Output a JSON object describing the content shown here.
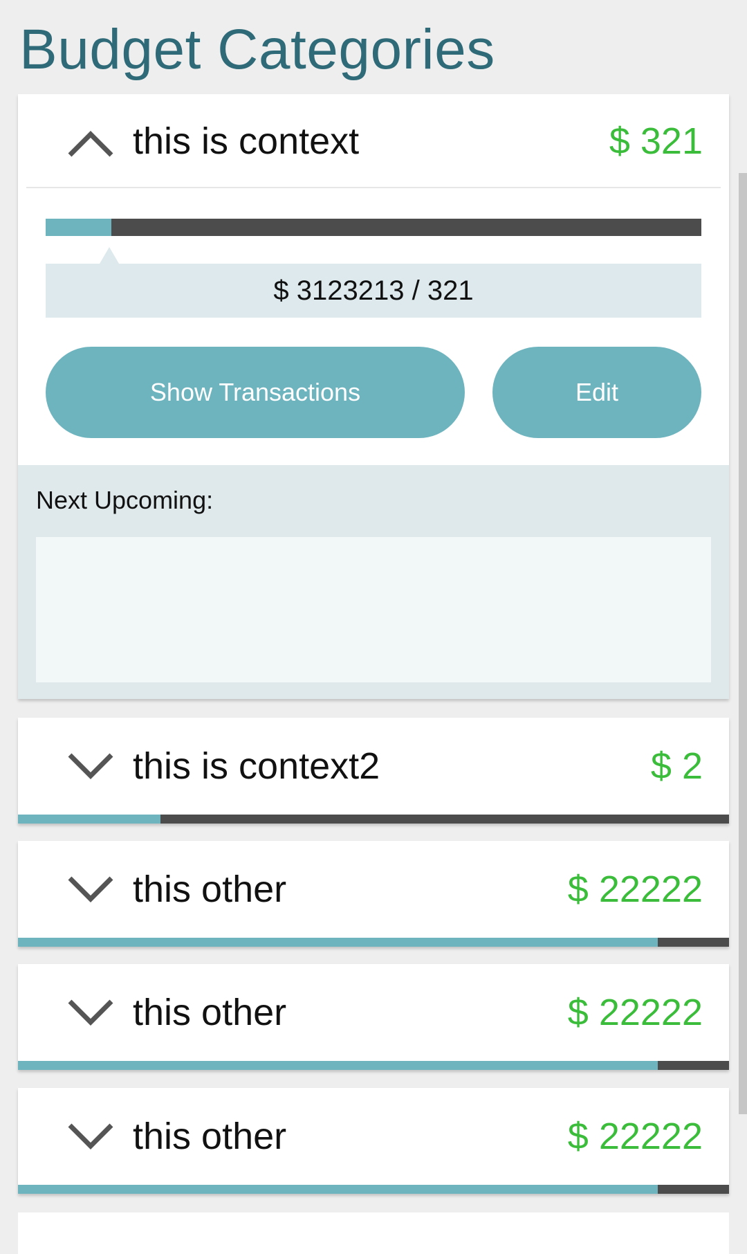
{
  "page": {
    "title": "Budget Categories"
  },
  "colors": {
    "title": "#2f6a78",
    "amount": "#3bbd3b",
    "accent": "#6eb4bf",
    "track": "#4c4c4c"
  },
  "expanded": {
    "name": "this is context",
    "amount": "$ 321",
    "chevron": "chevron-up-icon",
    "progress": 0.1,
    "spent_text": "$ 3123213 / 321",
    "show_transactions_label": "Show Transactions",
    "edit_label": "Edit",
    "upcoming_label": "Next Upcoming:"
  },
  "categories": [
    {
      "name": "this is context2",
      "amount": "$ 2",
      "progress": 0.2,
      "chevron": "chevron-down-icon"
    },
    {
      "name": "this other",
      "amount": "$ 22222",
      "progress": 0.9,
      "chevron": "chevron-down-icon"
    },
    {
      "name": "this other",
      "amount": "$ 22222",
      "progress": 0.9,
      "chevron": "chevron-down-icon"
    },
    {
      "name": "this other",
      "amount": "$ 22222",
      "progress": 0.9,
      "chevron": "chevron-down-icon"
    }
  ]
}
